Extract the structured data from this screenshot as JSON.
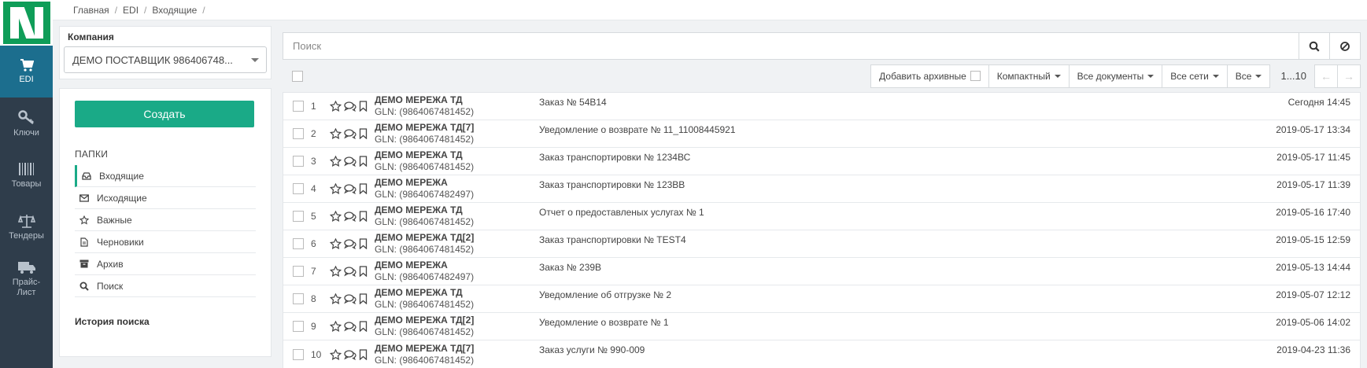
{
  "nav": {
    "items": [
      {
        "label": "EDI",
        "icon": "cart-icon"
      },
      {
        "label": "Ключи",
        "icon": "key-icon"
      },
      {
        "label": "Товары",
        "icon": "barcode-icon"
      },
      {
        "label": "Тендеры",
        "icon": "scales-icon"
      },
      {
        "label": "Прайс-Лист",
        "label1": "Прайс-",
        "label2": "Лист",
        "icon": "truck-icon"
      }
    ]
  },
  "breadcrumb": [
    "Главная",
    "EDI",
    "Входящие"
  ],
  "company": {
    "label": "Компания",
    "selected": "ДЕМО ПОСТАВЩИК 986406748..."
  },
  "create_label": "Создать",
  "folders": {
    "title": "ПАПКИ",
    "items": [
      {
        "label": "Входящие",
        "icon": "inbox-icon"
      },
      {
        "label": "Исходящие",
        "icon": "envelope-icon"
      },
      {
        "label": "Важные",
        "icon": "star-icon"
      },
      {
        "label": "Черновики",
        "icon": "draft-icon"
      },
      {
        "label": "Архив",
        "icon": "archive-icon"
      },
      {
        "label": "Поиск",
        "icon": "search-icon"
      }
    ],
    "history_label": "История поиска"
  },
  "search": {
    "placeholder": "Поиск"
  },
  "toolbar": {
    "add_archived": "Добавить архивные",
    "compact": "Компактный",
    "all_docs": "Все документы",
    "all_networks": "Все сети",
    "all": "Все",
    "page_range": "1...10"
  },
  "rows": [
    {
      "num": "1",
      "name": "ДЕМО МЕРЕЖА ТД",
      "gln": "GLN: (9864067481452)",
      "doc": "Заказ № 54В14",
      "date": "Сегодня 14:45"
    },
    {
      "num": "2",
      "name": "ДЕМО МЕРЕЖА ТД[7]",
      "gln": "GLN: (9864067481452)",
      "doc": "Уведомление о возврате № 11_11008445921",
      "date": "2019-05-17 13:34"
    },
    {
      "num": "3",
      "name": "ДЕМО МЕРЕЖА ТД",
      "gln": "GLN: (9864067481452)",
      "doc": "Заказ транспортировки № 1234ВС",
      "date": "2019-05-17 11:45"
    },
    {
      "num": "4",
      "name": "ДЕМО МЕРЕЖА",
      "gln": "GLN: (9864067482497)",
      "doc": "Заказ транспортировки № 123ВВ",
      "date": "2019-05-17 11:39"
    },
    {
      "num": "5",
      "name": "ДЕМО МЕРЕЖА ТД",
      "gln": "GLN: (9864067481452)",
      "doc": "Отчет о предоставленых услугах № 1",
      "date": "2019-05-16 17:40"
    },
    {
      "num": "6",
      "name": "ДЕМО МЕРЕЖА ТД[2]",
      "gln": "GLN: (9864067481452)",
      "doc": "Заказ транспортировки № TEST4",
      "date": "2019-05-15 12:59"
    },
    {
      "num": "7",
      "name": "ДЕМО МЕРЕЖА",
      "gln": "GLN: (9864067482497)",
      "doc": "Заказ № 239В",
      "date": "2019-05-13 14:44"
    },
    {
      "num": "8",
      "name": "ДЕМО МЕРЕЖА ТД",
      "gln": "GLN: (9864067481452)",
      "doc": "Уведомление об отгрузке № 2",
      "date": "2019-05-07 12:12"
    },
    {
      "num": "9",
      "name": "ДЕМО МЕРЕЖА ТД[2]",
      "gln": "GLN: (9864067481452)",
      "doc": "Уведомление о возврате № 1",
      "date": "2019-05-06 14:02"
    },
    {
      "num": "10",
      "name": "ДЕМО МЕРЕЖА ТД[7]",
      "gln": "GLN: (9864067481452)",
      "doc": "Заказ услуги № 990-009",
      "date": "2019-04-23 11:36"
    }
  ],
  "colors": {
    "accent": "#1aaa87",
    "nav_bg": "#2f3d4b",
    "logo_green": "#0f9d58"
  }
}
